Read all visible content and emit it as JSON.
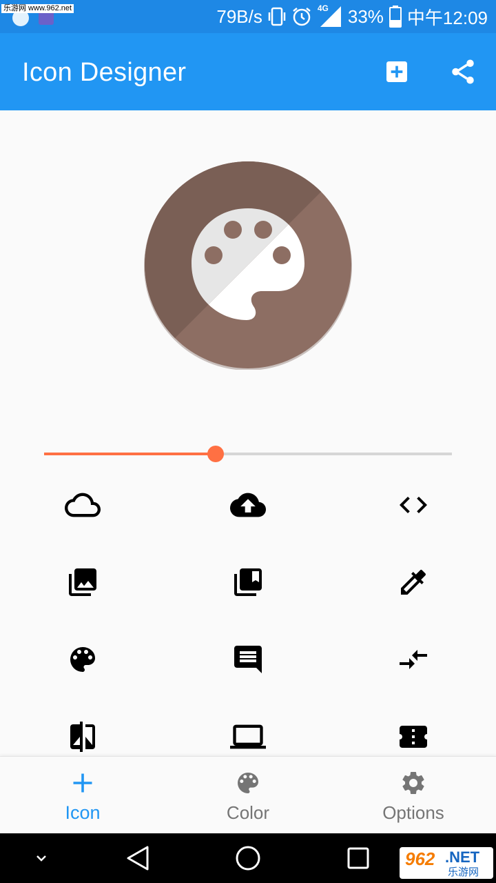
{
  "status_bar": {
    "watermark": "乐游网 www.962.net",
    "net_speed": "79B/s",
    "network": "4G",
    "battery": "33%",
    "time": "中午12:09"
  },
  "app_bar": {
    "title": "Icon Designer",
    "actions": [
      "add-box-icon",
      "share-icon"
    ]
  },
  "preview": {
    "icon": "palette-icon",
    "background_color": "#8d6e63",
    "foreground_color": "#ffffff",
    "shape": "circle"
  },
  "slider": {
    "value_fraction": 0.42,
    "active_color": "#ff7043",
    "inactive_color": "#d6d6d6"
  },
  "icon_grid": [
    "cloud-outline-icon",
    "cloud-upload-icon",
    "code-icon",
    "photo-library-icon",
    "collections-bookmark-icon",
    "colorize-icon",
    "palette-icon",
    "comment-icon",
    "compare-arrows-icon",
    "compare-icon",
    "computer-icon",
    "confirmation-number-icon"
  ],
  "bottom_nav": {
    "items": [
      {
        "label": "Icon",
        "icon": "add-icon",
        "active": true
      },
      {
        "label": "Color",
        "icon": "palette-icon",
        "active": false
      },
      {
        "label": "Options",
        "icon": "settings-icon",
        "active": false
      }
    ],
    "active_color": "#2196f3",
    "inactive_color": "#757575"
  },
  "system_nav": {
    "buttons": [
      "chevron-down-icon",
      "back-icon",
      "home-icon",
      "recents-icon"
    ]
  },
  "site_badge": {
    "number": "962",
    "suffix": ".NET",
    "name": "乐游网"
  }
}
